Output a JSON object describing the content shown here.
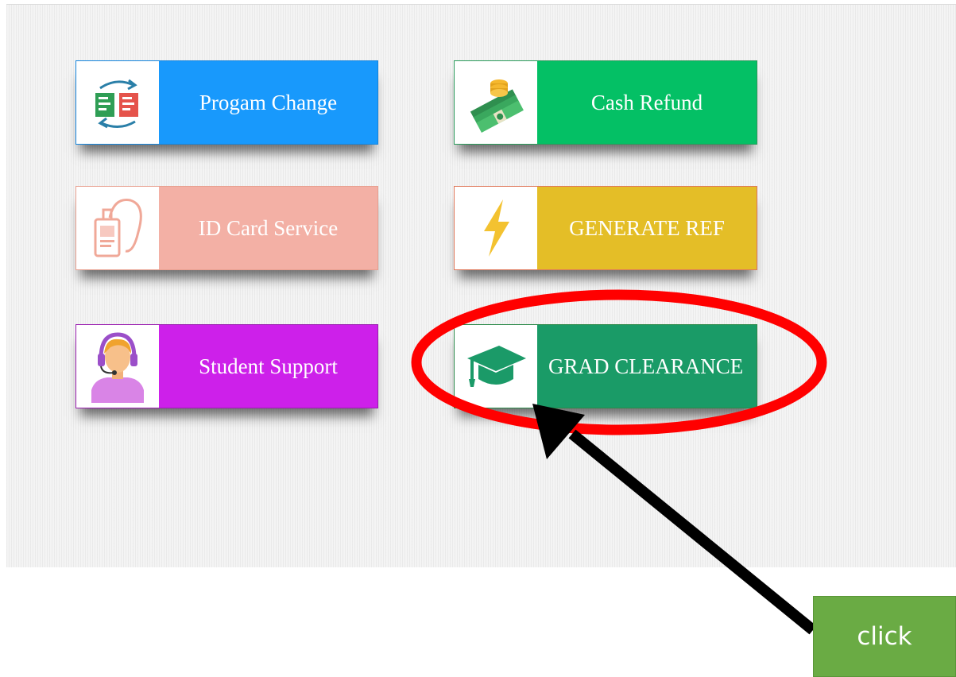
{
  "tiles": [
    {
      "label": "Progam Change",
      "icon": "program-change-icon",
      "color": "#1899fc"
    },
    {
      "label": "Cash Refund",
      "icon": "cash-refund-icon",
      "color": "#04c065"
    },
    {
      "label": "ID Card Service",
      "icon": "id-card-icon",
      "color": "#f3b0a5"
    },
    {
      "label": "GENERATE REF",
      "icon": "lightning-icon",
      "color": "#e4be27"
    },
    {
      "label": "Student Support",
      "icon": "student-support-icon",
      "color": "#cd20ea"
    },
    {
      "label": "GRAD CLEARANCE",
      "icon": "graduation-cap-icon",
      "color": "#1a9b67"
    }
  ],
  "annotation": {
    "button_label": "click",
    "button_color": "#6aab44",
    "ellipse_color": "#ff0000",
    "arrow_color": "#000000"
  }
}
